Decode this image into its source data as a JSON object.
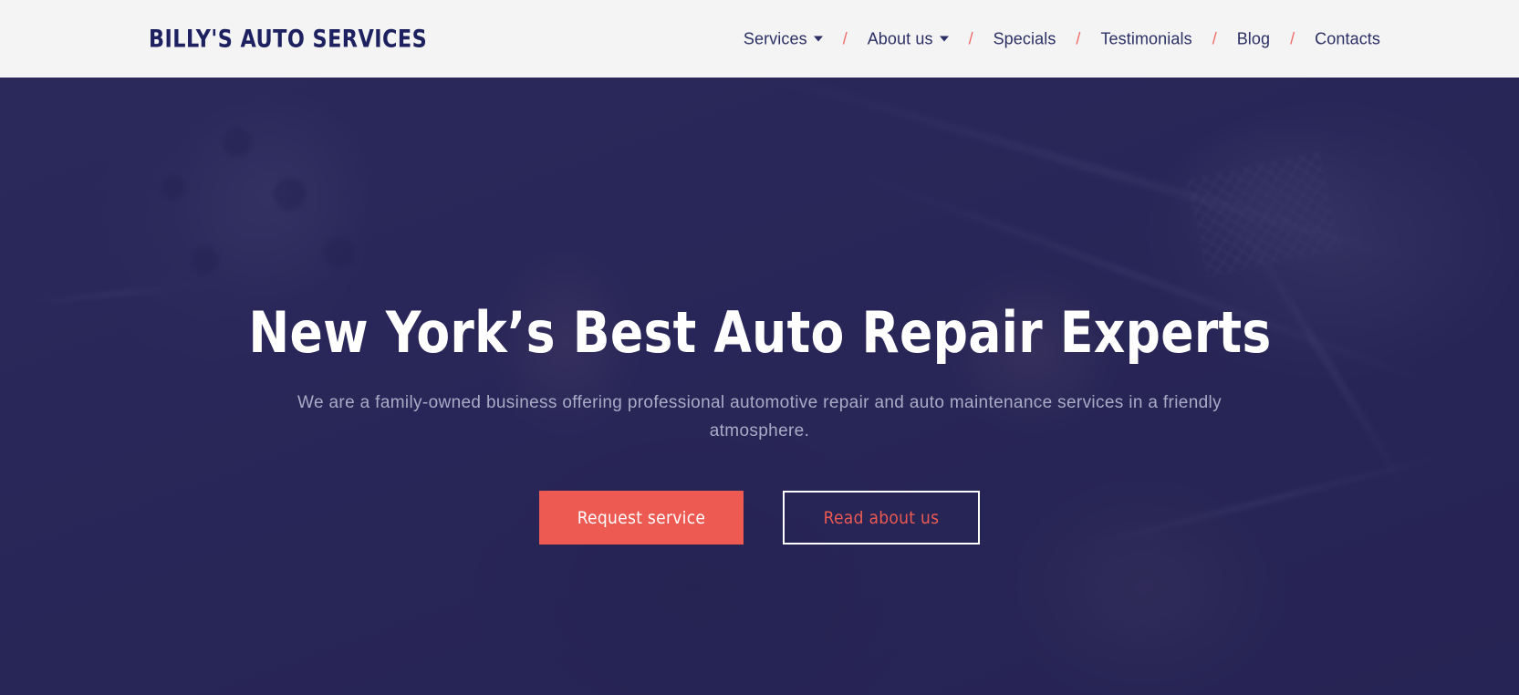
{
  "header": {
    "logo": "BILLY'S AUTO SERVICES",
    "background_color": "#F4F4F5",
    "nav_text_color": "#2B2F63",
    "separator_color": "#EF6B63",
    "separator": "/",
    "nav": [
      {
        "label": "Services",
        "has_dropdown": true
      },
      {
        "label": "About us",
        "has_dropdown": true
      },
      {
        "label": "Specials",
        "has_dropdown": false
      },
      {
        "label": "Testimonials",
        "has_dropdown": false
      },
      {
        "label": "Blog",
        "has_dropdown": false
      },
      {
        "label": "Contacts",
        "has_dropdown": false
      }
    ]
  },
  "hero": {
    "headline": "New York’s Best Auto Repair Experts",
    "subtitle": "We are a family-owned business offering professional automotive repair and auto maintenance services in a friendly atmosphere.",
    "overlay_color": "#282658",
    "headline_color": "#FFFFFF",
    "subtitle_color": "#A9ABC6",
    "accent_color": "#EC5A52",
    "buttons": {
      "primary": "Request service",
      "secondary": "Read about us"
    }
  }
}
